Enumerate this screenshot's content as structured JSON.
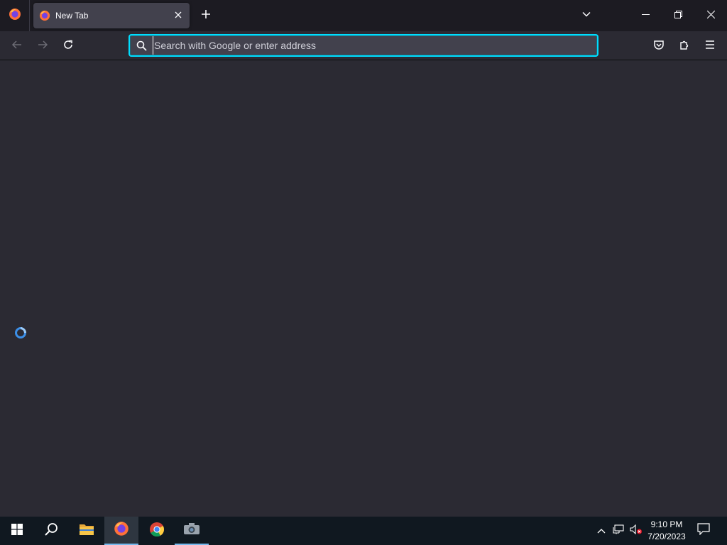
{
  "browser": {
    "tab": {
      "title": "New Tab"
    },
    "urlbar": {
      "placeholder": "Search with Google or enter address",
      "value": ""
    }
  },
  "taskbar": {
    "clock": {
      "time": "9:10 PM",
      "date": "7/20/2023"
    }
  },
  "colors": {
    "urlbar_focus": "#00ddff",
    "content_bg": "#2b2a33",
    "loading_indicator": "#3c8fe8",
    "taskbar_active": "#76b9ed"
  },
  "icons": {
    "app_menu": "firefox-icon",
    "tab_favicon": "firefox-icon",
    "tab_close": "close-icon",
    "new_tab": "plus-icon",
    "list_tabs": "chevron-down-icon",
    "back": "arrow-left-icon",
    "forward": "arrow-right-icon",
    "reload": "reload-icon",
    "urlbar_search": "search-icon",
    "pocket": "pocket-icon",
    "extensions": "puzzle-icon",
    "menu": "hamburger-icon",
    "start": "windows-icon",
    "taskbar_search": "search-icon",
    "explorer": "folder-icon",
    "chrome": "chrome-icon",
    "camera": "camera-icon",
    "tray_chevron": "chevron-up-icon",
    "network": "network-icon",
    "volume": "volume-muted-icon",
    "notifications": "notification-icon"
  }
}
